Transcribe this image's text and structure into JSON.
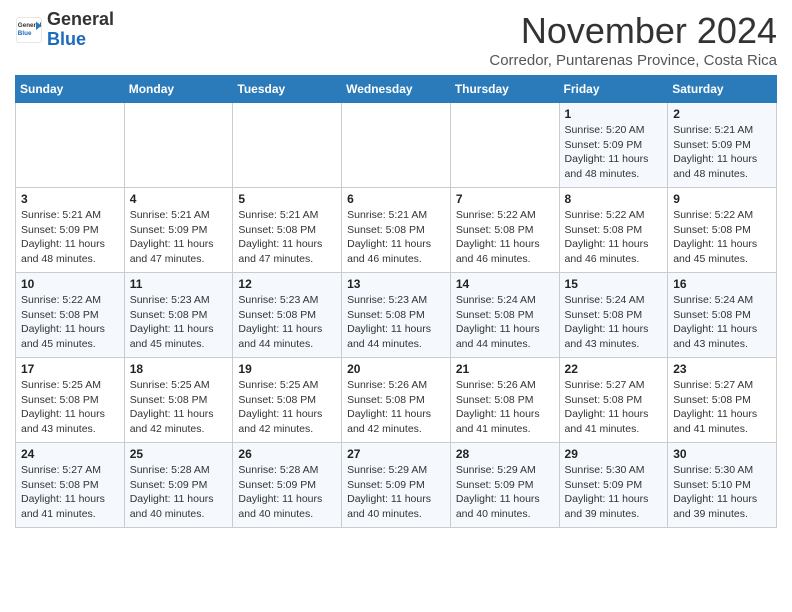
{
  "header": {
    "logo_general": "General",
    "logo_blue": "Blue",
    "month_title": "November 2024",
    "location": "Corredor, Puntarenas Province, Costa Rica"
  },
  "days_of_week": [
    "Sunday",
    "Monday",
    "Tuesday",
    "Wednesday",
    "Thursday",
    "Friday",
    "Saturday"
  ],
  "weeks": [
    [
      {
        "day": "",
        "info": ""
      },
      {
        "day": "",
        "info": ""
      },
      {
        "day": "",
        "info": ""
      },
      {
        "day": "",
        "info": ""
      },
      {
        "day": "",
        "info": ""
      },
      {
        "day": "1",
        "info": "Sunrise: 5:20 AM\nSunset: 5:09 PM\nDaylight: 11 hours and 48 minutes."
      },
      {
        "day": "2",
        "info": "Sunrise: 5:21 AM\nSunset: 5:09 PM\nDaylight: 11 hours and 48 minutes."
      }
    ],
    [
      {
        "day": "3",
        "info": "Sunrise: 5:21 AM\nSunset: 5:09 PM\nDaylight: 11 hours and 48 minutes."
      },
      {
        "day": "4",
        "info": "Sunrise: 5:21 AM\nSunset: 5:09 PM\nDaylight: 11 hours and 47 minutes."
      },
      {
        "day": "5",
        "info": "Sunrise: 5:21 AM\nSunset: 5:08 PM\nDaylight: 11 hours and 47 minutes."
      },
      {
        "day": "6",
        "info": "Sunrise: 5:21 AM\nSunset: 5:08 PM\nDaylight: 11 hours and 46 minutes."
      },
      {
        "day": "7",
        "info": "Sunrise: 5:22 AM\nSunset: 5:08 PM\nDaylight: 11 hours and 46 minutes."
      },
      {
        "day": "8",
        "info": "Sunrise: 5:22 AM\nSunset: 5:08 PM\nDaylight: 11 hours and 46 minutes."
      },
      {
        "day": "9",
        "info": "Sunrise: 5:22 AM\nSunset: 5:08 PM\nDaylight: 11 hours and 45 minutes."
      }
    ],
    [
      {
        "day": "10",
        "info": "Sunrise: 5:22 AM\nSunset: 5:08 PM\nDaylight: 11 hours and 45 minutes."
      },
      {
        "day": "11",
        "info": "Sunrise: 5:23 AM\nSunset: 5:08 PM\nDaylight: 11 hours and 45 minutes."
      },
      {
        "day": "12",
        "info": "Sunrise: 5:23 AM\nSunset: 5:08 PM\nDaylight: 11 hours and 44 minutes."
      },
      {
        "day": "13",
        "info": "Sunrise: 5:23 AM\nSunset: 5:08 PM\nDaylight: 11 hours and 44 minutes."
      },
      {
        "day": "14",
        "info": "Sunrise: 5:24 AM\nSunset: 5:08 PM\nDaylight: 11 hours and 44 minutes."
      },
      {
        "day": "15",
        "info": "Sunrise: 5:24 AM\nSunset: 5:08 PM\nDaylight: 11 hours and 43 minutes."
      },
      {
        "day": "16",
        "info": "Sunrise: 5:24 AM\nSunset: 5:08 PM\nDaylight: 11 hours and 43 minutes."
      }
    ],
    [
      {
        "day": "17",
        "info": "Sunrise: 5:25 AM\nSunset: 5:08 PM\nDaylight: 11 hours and 43 minutes."
      },
      {
        "day": "18",
        "info": "Sunrise: 5:25 AM\nSunset: 5:08 PM\nDaylight: 11 hours and 42 minutes."
      },
      {
        "day": "19",
        "info": "Sunrise: 5:25 AM\nSunset: 5:08 PM\nDaylight: 11 hours and 42 minutes."
      },
      {
        "day": "20",
        "info": "Sunrise: 5:26 AM\nSunset: 5:08 PM\nDaylight: 11 hours and 42 minutes."
      },
      {
        "day": "21",
        "info": "Sunrise: 5:26 AM\nSunset: 5:08 PM\nDaylight: 11 hours and 41 minutes."
      },
      {
        "day": "22",
        "info": "Sunrise: 5:27 AM\nSunset: 5:08 PM\nDaylight: 11 hours and 41 minutes."
      },
      {
        "day": "23",
        "info": "Sunrise: 5:27 AM\nSunset: 5:08 PM\nDaylight: 11 hours and 41 minutes."
      }
    ],
    [
      {
        "day": "24",
        "info": "Sunrise: 5:27 AM\nSunset: 5:08 PM\nDaylight: 11 hours and 41 minutes."
      },
      {
        "day": "25",
        "info": "Sunrise: 5:28 AM\nSunset: 5:09 PM\nDaylight: 11 hours and 40 minutes."
      },
      {
        "day": "26",
        "info": "Sunrise: 5:28 AM\nSunset: 5:09 PM\nDaylight: 11 hours and 40 minutes."
      },
      {
        "day": "27",
        "info": "Sunrise: 5:29 AM\nSunset: 5:09 PM\nDaylight: 11 hours and 40 minutes."
      },
      {
        "day": "28",
        "info": "Sunrise: 5:29 AM\nSunset: 5:09 PM\nDaylight: 11 hours and 40 minutes."
      },
      {
        "day": "29",
        "info": "Sunrise: 5:30 AM\nSunset: 5:09 PM\nDaylight: 11 hours and 39 minutes."
      },
      {
        "day": "30",
        "info": "Sunrise: 5:30 AM\nSunset: 5:10 PM\nDaylight: 11 hours and 39 minutes."
      }
    ]
  ]
}
